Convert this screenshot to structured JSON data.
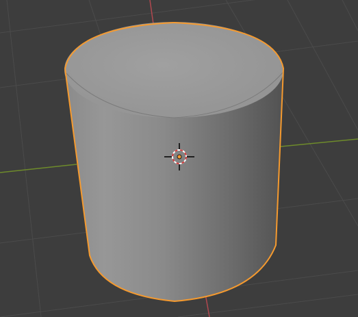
{
  "viewport": {
    "type": "3d-viewport",
    "background_color": "#3d3d3d",
    "grid_line_color": "#4a4a4a",
    "x_axis_color": "#b0484f",
    "y_axis_color": "#6e8b2b"
  },
  "selected_object": {
    "shape": "cylinder",
    "selected": true,
    "outline_color": "#f59a2f",
    "top_face_color": "#9b9b9b",
    "side_color_light": "#8f8f8f",
    "side_color_dark": "#5a5a5a"
  },
  "origin": {
    "icon": "object-origin-dot",
    "color": "#f59a2f"
  },
  "cursor_3d": {
    "icon": "3d-cursor-icon",
    "ring_color_a": "#ffffff",
    "ring_color_b": "#d23b3b",
    "cross_color": "#000000"
  }
}
